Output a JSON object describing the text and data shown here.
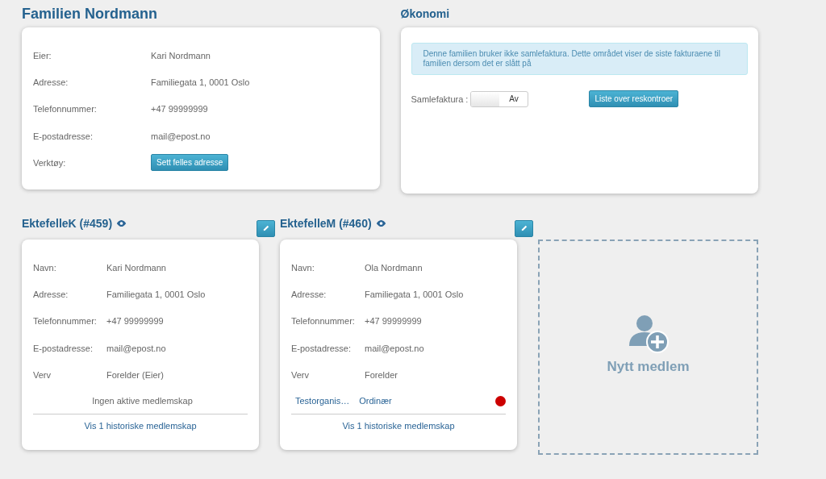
{
  "family": {
    "title": "Familien Nordmann",
    "fields": [
      {
        "label": "Eier:",
        "value": "Kari Nordmann"
      },
      {
        "label": "Adresse:",
        "value": "Familiegata 1, 0001 Oslo"
      },
      {
        "label": "Telefonnummer:",
        "value": "+47 99999999"
      },
      {
        "label": "E-postadresse:",
        "value": "mail@epost.no"
      }
    ],
    "tools_label": "Verktøy:",
    "tools_button": "Sett felles adresse"
  },
  "economy": {
    "title": "Økonomi",
    "info": "Denne familien bruker ikke samlefaktura. Dette området viser de siste fakturaene til familien dersom det er slått på",
    "toggle": {
      "label": "Samlefaktura :",
      "state_text": "Av",
      "on": false
    },
    "button": "Liste over reskontroer"
  },
  "members": [
    {
      "title": "EktefelleK (#459)",
      "fields": [
        {
          "label": "Navn:",
          "value": "Kari Nordmann"
        },
        {
          "label": "Adresse:",
          "value": "Familiegata 1, 0001 Oslo"
        },
        {
          "label": "Telefonnummer:",
          "value": "+47 99999999"
        },
        {
          "label": "E-postadresse:",
          "value": "mail@epost.no"
        },
        {
          "label": "Verv",
          "value": "Forelder (Eier)"
        }
      ],
      "no_memberships": "Ingen aktive medlemskap",
      "history_link": "Vis 1 historiske medlemskap"
    },
    {
      "title": "EktefelleM (#460)",
      "fields": [
        {
          "label": "Navn:",
          "value": "Ola Nordmann"
        },
        {
          "label": "Adresse:",
          "value": "Familiegata 1, 0001 Oslo"
        },
        {
          "label": "Telefonnummer:",
          "value": "+47 99999999"
        },
        {
          "label": "E-postadresse:",
          "value": "mail@epost.no"
        },
        {
          "label": "Verv",
          "value": "Forelder"
        }
      ],
      "memberships": [
        {
          "organization": "Testorganis…",
          "type": "Ordinær",
          "color": "#cc0000"
        }
      ],
      "history_link": "Vis 1 historiske medlemskap"
    }
  ],
  "new_member": {
    "label": "Nytt medlem"
  }
}
